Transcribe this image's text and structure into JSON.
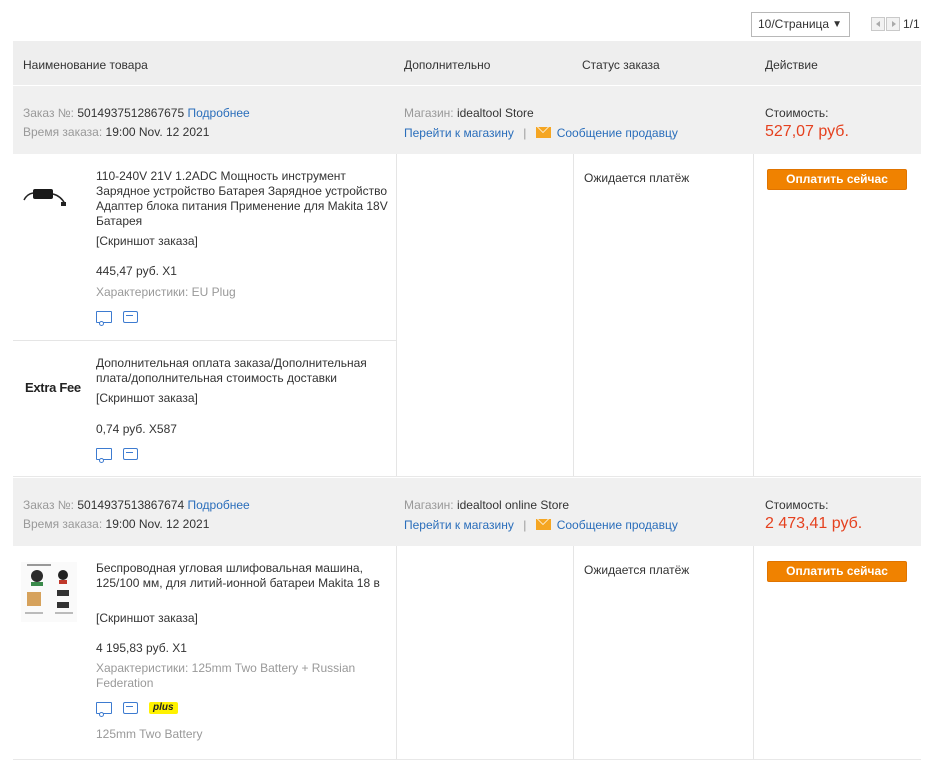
{
  "pager": {
    "page_size": "10/Страница",
    "page_count": "1/1"
  },
  "table_header": {
    "col_name": "Наименование товара",
    "col_extra": "Дополнительно",
    "col_status": "Статус заказа",
    "col_action": "Действие"
  },
  "orders": [
    {
      "order_label": "Заказ №:",
      "order_number": "5014937512867675",
      "details_link": "Подробнее",
      "time_label": "Время заказа:",
      "time_value": "19:00 Nov. 12 2021",
      "store_label": "Магазин:",
      "store_name": "idealtool Store",
      "go_to_store": "Перейти к магазину",
      "separator": "|",
      "message_seller": "Сообщение продавцу",
      "cost_label": "Стоимость:",
      "cost_value": "527,07 руб.",
      "status": "Ожидается платёж",
      "pay_button": "Оплатить сейчас",
      "items": [
        {
          "title": "110-240V 21V 1.2ADC Мощность инструмент Зарядное устройство Батарея Зарядное устройство Адаптер блока питания Применение для Makita 18V Батарея",
          "snapshot": "[Скриншот заказа]",
          "price_qty": "445,47 руб. X1",
          "specs": "Характеристики: EU Plug",
          "icons": [
            "delivery-truck-icon",
            "return-icon"
          ]
        },
        {
          "thumb_text": "Extra Fee",
          "title": "Дополнительная оплата заказа/Дополнительная плата/дополнительная стоимость доставки",
          "snapshot": "[Скриншот заказа]",
          "price_qty": "0,74 руб. X587",
          "icons": [
            "delivery-truck-icon",
            "return-icon"
          ]
        }
      ]
    },
    {
      "order_label": "Заказ №:",
      "order_number": "5014937513867674",
      "details_link": "Подробнее",
      "time_label": "Время заказа:",
      "time_value": "19:00 Nov. 12 2021",
      "store_label": "Магазин:",
      "store_name": "idealtool online Store",
      "go_to_store": "Перейти к магазину",
      "separator": "|",
      "message_seller": "Сообщение продавцу",
      "cost_label": "Стоимость:",
      "cost_value": "2 473,41 руб.",
      "status": "Ожидается платёж",
      "pay_button": "Оплатить сейчас",
      "items": [
        {
          "title": "Беспроводная угловая шлифовальная машина, 125/100 мм, для литий-ионной батареи Makita 18 в",
          "snapshot": "[Скриншот заказа]",
          "price_qty": "4 195,83 руб. X1",
          "specs": "Характеристики: 125mm Two Battery + Russian Federation",
          "icons": [
            "delivery-truck-icon",
            "return-icon"
          ],
          "badge": "plus",
          "variant_note": "125mm Two Battery"
        }
      ]
    }
  ],
  "colors": {
    "accent_orange": "#f08200",
    "price_red": "#e5411f",
    "link_blue": "#2a6ebb",
    "header_bg": "#eeeeee",
    "plus_yellow": "#fff200"
  }
}
